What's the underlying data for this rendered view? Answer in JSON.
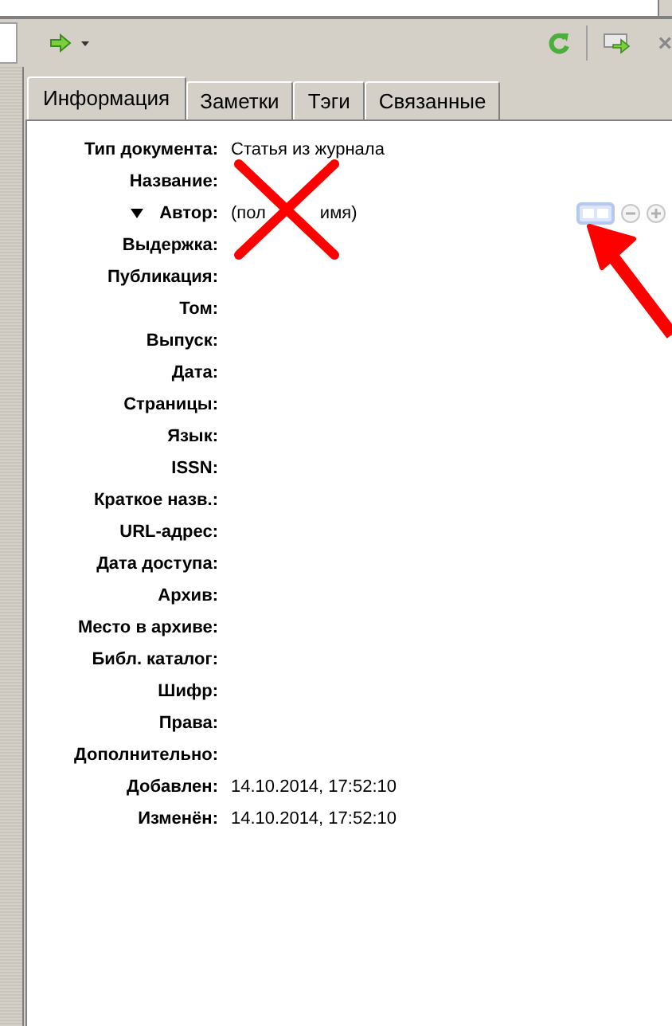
{
  "toolbar": {
    "close": "×"
  },
  "tabs": [
    {
      "label": "Информация",
      "selected": true
    },
    {
      "label": "Заметки",
      "selected": false
    },
    {
      "label": "Тэги",
      "selected": false
    },
    {
      "label": "Связанные",
      "selected": false
    }
  ],
  "fields": [
    {
      "kind": "text",
      "label": "Тип документа:",
      "value": "Статья из журнала"
    },
    {
      "kind": "text",
      "label": "Название:"
    },
    {
      "kind": "creator",
      "label": "Автор:",
      "value_parts": [
        "(пол",
        "имя)"
      ],
      "expanded": true
    },
    {
      "kind": "text",
      "label": "Выдержка:"
    },
    {
      "kind": "text",
      "label": "Публикация:"
    },
    {
      "kind": "text",
      "label": "Том:"
    },
    {
      "kind": "text",
      "label": "Выпуск:"
    },
    {
      "kind": "text",
      "label": "Дата:"
    },
    {
      "kind": "text",
      "label": "Страницы:"
    },
    {
      "kind": "text",
      "label": "Язык:"
    },
    {
      "kind": "text",
      "label": "ISSN:"
    },
    {
      "kind": "text",
      "label": "Краткое назв.:"
    },
    {
      "kind": "text",
      "label": "URL-адрес:"
    },
    {
      "kind": "text",
      "label": "Дата доступа:"
    },
    {
      "kind": "text",
      "label": "Архив:"
    },
    {
      "kind": "text",
      "label": "Место в архиве:"
    },
    {
      "kind": "text",
      "label": "Библ. каталог:"
    },
    {
      "kind": "text",
      "label": "Шифр:"
    },
    {
      "kind": "text",
      "label": "Права:"
    },
    {
      "kind": "text",
      "label": "Дополнительно:"
    },
    {
      "kind": "text",
      "label": "Добавлен:",
      "value": "14.10.2014, 17:52:10"
    },
    {
      "kind": "text",
      "label": "Изменён:",
      "value": "14.10.2014, 17:52:10"
    }
  ]
}
